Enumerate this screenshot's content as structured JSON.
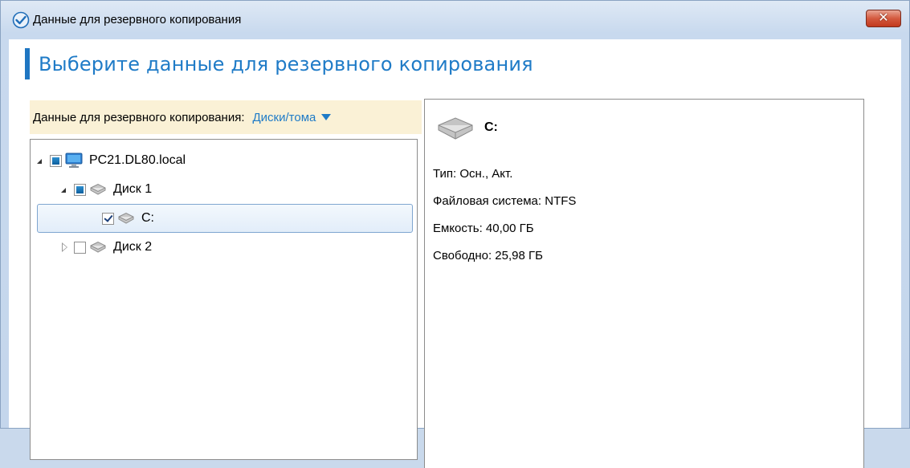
{
  "window": {
    "title": "Данные для резервного копирования",
    "close_label": "✕"
  },
  "heading": "Выберите данные для резервного копирования",
  "filter": {
    "label": "Данные для резервного копирования:",
    "value": "Диски/тома"
  },
  "tree": {
    "items": [
      {
        "label": "PC21.DL80.local",
        "icon": "computer-icon",
        "check_state": "partial",
        "expanded": true
      },
      {
        "label": "Диск 1",
        "icon": "disk-icon",
        "check_state": "partial",
        "expanded": true
      },
      {
        "label": "C:",
        "icon": "disk-icon",
        "check_state": "checked",
        "selected": true
      },
      {
        "label": "Диск 2",
        "icon": "disk-icon",
        "check_state": "unchecked",
        "expanded": false
      }
    ]
  },
  "details": {
    "title": "C:",
    "type": "Тип: Осн., Акт.",
    "filesystem": "Файловая система: NTFS",
    "capacity": "Емкость: 40,00 ГБ",
    "free": "Свободно: 25,98 ГБ"
  },
  "colors": {
    "accent": "#1f7bc7",
    "filter_background": "#faf1d6",
    "selection_border": "#7fa6d0"
  }
}
